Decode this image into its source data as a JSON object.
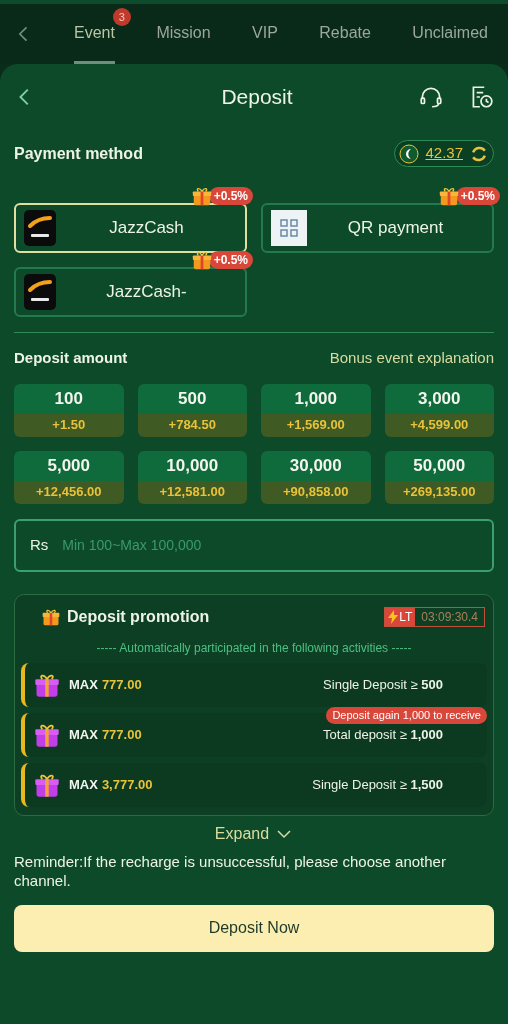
{
  "top_tabs": [
    {
      "label": "Event",
      "selected": true,
      "badge": "3"
    },
    {
      "label": "Mission",
      "selected": false
    },
    {
      "label": "VIP",
      "selected": false
    },
    {
      "label": "Rebate",
      "selected": false
    },
    {
      "label": "Unclaimed",
      "selected": false
    }
  ],
  "header": {
    "title": "Deposit"
  },
  "payment": {
    "heading": "Payment method",
    "balance": "42.37",
    "methods": [
      {
        "name": "JazzCash",
        "kind": "jazzcash",
        "bonus": "+0.5%",
        "selected": true
      },
      {
        "name": "QR payment",
        "kind": "qr",
        "bonus": "+0.5%",
        "selected": false
      },
      {
        "name": "JazzCash-",
        "kind": "jazzcash",
        "bonus": "+0.5%",
        "selected": false
      }
    ]
  },
  "amount": {
    "heading": "Deposit amount",
    "link": "Bonus event explanation",
    "options": [
      {
        "value": "100",
        "bonus": "+1.50"
      },
      {
        "value": "500",
        "bonus": "+784.50"
      },
      {
        "value": "1,000",
        "bonus": "+1,569.00"
      },
      {
        "value": "3,000",
        "bonus": "+4,599.00"
      },
      {
        "value": "5,000",
        "bonus": "+12,456.00"
      },
      {
        "value": "10,000",
        "bonus": "+12,581.00"
      },
      {
        "value": "30,000",
        "bonus": "+90,858.00"
      },
      {
        "value": "50,000",
        "bonus": "+269,135.00"
      }
    ],
    "currency": "Rs",
    "placeholder": "Min 100~Max 100,000"
  },
  "promotion": {
    "title": "Deposit promotion",
    "timer_tag": "LT",
    "timer": "03:09:30.4",
    "note": "----- Automatically participated in the following activities -----",
    "items": [
      {
        "label": "MAX",
        "amount": "777.00",
        "condition": "Single Deposit ≥ **500**"
      },
      {
        "label": "MAX",
        "amount": "777.00",
        "condition": "Total deposit ≥ **1,000**",
        "tip": "Deposit again 1,000 to receive"
      },
      {
        "label": "MAX",
        "amount": "3,777.00",
        "condition": "Single Deposit ≥ **1,500**"
      }
    ],
    "expand": "Expand"
  },
  "reminder": "Reminder:If the recharge is unsuccessful, please choose another channel.",
  "submit": "Deposit Now"
}
